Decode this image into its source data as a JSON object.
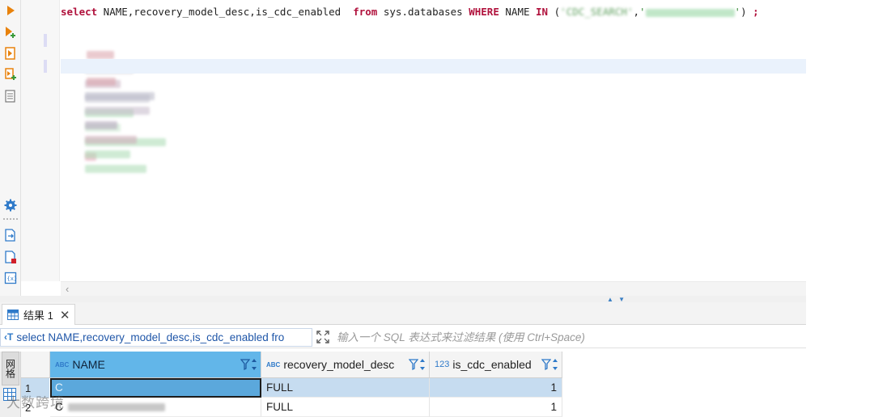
{
  "editor": {
    "sql_tokens": {
      "select": "select",
      "columns": " NAME,recovery_model_desc,is_cdc_enabled  ",
      "from": "from",
      "table": " sys.databases ",
      "where": "WHERE",
      "name_col": " NAME ",
      "in": "IN",
      "list_open": " (",
      "str1_visible": "'CDC_SEARCH'",
      "comma": ",",
      "str2_open": "'",
      "str2_close": "'",
      "list_close": ") ",
      "terminator": ";"
    }
  },
  "toolbar": {
    "icons": [
      "execute-statement-icon",
      "execute-statement-new-tab-icon",
      "execute-script-icon",
      "execute-script-new-tab-icon",
      "explain-plan-icon",
      "settings-icon",
      "load-script-icon",
      "export-script-icon",
      "variables-icon"
    ]
  },
  "results": {
    "tab_label": "结果 1",
    "query_echo": "select NAME,recovery_model_desc,is_cdc_enabled fro",
    "filter_placeholder": "输入一个 SQL 表达式来过滤结果 (使用 Ctrl+Space)",
    "vertical_tab_label": "网格",
    "columns": [
      {
        "label": "NAME",
        "type_badge": "ABC"
      },
      {
        "label": "recovery_model_desc",
        "type_badge": "ABC"
      },
      {
        "label": "is_cdc_enabled",
        "type_badge": "123"
      }
    ],
    "rows": [
      {
        "num": "1",
        "name": "C",
        "recovery_model_desc": "FULL",
        "is_cdc_enabled": "1"
      },
      {
        "num": "2",
        "name": "C",
        "recovery_model_desc": "FULL",
        "is_cdc_enabled": "1"
      }
    ]
  },
  "watermark": "大数跨境",
  "colors": {
    "keyword": "#b0113c",
    "string": "#3a8a3a",
    "selection_header": "#62b6e9",
    "selected_row": "#c6dcf0",
    "accent": "#2f7ac9"
  }
}
